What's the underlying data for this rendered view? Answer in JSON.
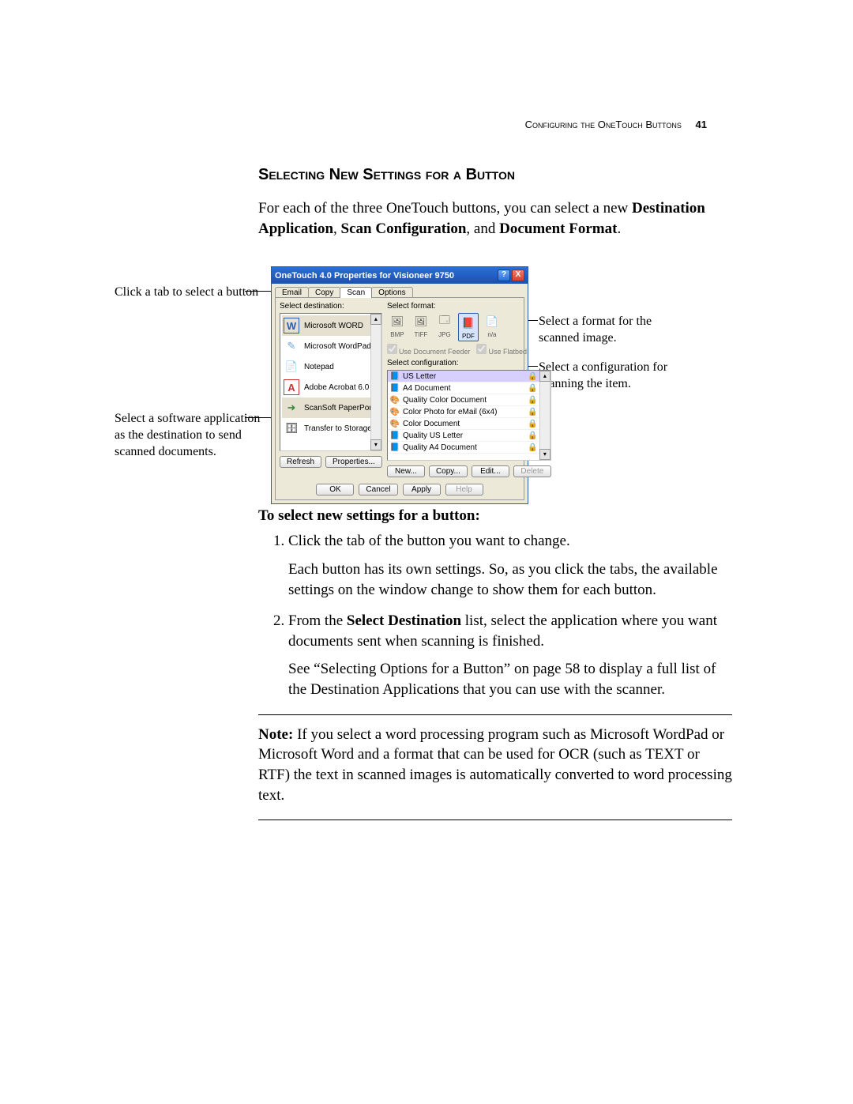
{
  "header": {
    "running": "Configuring the OneTouch Buttons",
    "page_num": "41"
  },
  "section_title": "Selecting New Settings for a Button",
  "intro": {
    "pre": "For each of the three OneTouch buttons, you can select a new ",
    "b1": "Destination Application",
    "sep1": ", ",
    "b2": "Scan Configuration",
    "sep2": ", and ",
    "b3": "Document Format",
    "post": "."
  },
  "callouts": {
    "tab": "Click a tab to select a button",
    "dest": "Select a software application as the destination to send scanned documents.",
    "fmt": "Select a format for the scanned image.",
    "cfg": "Select a configuration for scanning the item."
  },
  "dialog": {
    "title": "OneTouch 4.0 Properties for Visioneer 9750",
    "help_btn": "?",
    "close_btn": "X",
    "tabs": [
      "Email",
      "Copy",
      "Scan",
      "Options"
    ],
    "active_tab": 2,
    "labels": {
      "dest": "Select destination:",
      "fmt": "Select format:",
      "cfg": "Select configuration:"
    },
    "destinations": [
      {
        "icon": "W",
        "iconColor": "#2a5db0",
        "label": "Microsoft WORD",
        "selected": true
      },
      {
        "icon": "✎",
        "iconColor": "#6aa5e8",
        "label": "Microsoft WordPad"
      },
      {
        "icon": "📄",
        "iconColor": "#888",
        "label": "Notepad"
      },
      {
        "icon": "A",
        "iconColor": "#c33",
        "label": "Adobe Acrobat 6.0"
      },
      {
        "icon": "➜",
        "iconColor": "#3a8a3a",
        "label": "ScanSoft PaperPort",
        "selected": true
      },
      {
        "icon": "🗄",
        "iconColor": "#c7a24a",
        "label": "Transfer to Storage"
      }
    ],
    "formats": [
      {
        "abbr": "BMP",
        "glyph": "🖼"
      },
      {
        "abbr": "TIFF",
        "glyph": "🖼"
      },
      {
        "abbr": "JPG",
        "glyph": "🗔"
      },
      {
        "abbr": "PDF",
        "glyph": "📕",
        "selected": true
      },
      {
        "abbr": "n/a",
        "glyph": "📄"
      }
    ],
    "checkboxes": {
      "feeder": "Use Document Feeder",
      "flatbed": "Use Flatbed"
    },
    "configs": [
      {
        "icon": "📘",
        "label": "US Letter",
        "selected": true
      },
      {
        "icon": "📘",
        "label": "A4 Document"
      },
      {
        "icon": "🎨",
        "label": "Quality Color Document"
      },
      {
        "icon": "🎨",
        "label": "Color Photo for eMail (6x4)"
      },
      {
        "icon": "🎨",
        "label": "Color Document"
      },
      {
        "icon": "📘",
        "label": "Quality US Letter"
      },
      {
        "icon": "📘",
        "label": "Quality A4 Document"
      }
    ],
    "buttons": {
      "refresh": "Refresh",
      "properties": "Properties...",
      "new": "New...",
      "copy": "Copy...",
      "edit": "Edit...",
      "delete": "Delete",
      "ok": "OK",
      "cancel": "Cancel",
      "apply": "Apply",
      "help": "Help"
    }
  },
  "instr_heading": "To select new settings for a button:",
  "steps": {
    "s1a": "Click the tab of the button you want to change.",
    "s1b": "Each button has its own settings. So, as you click the tabs, the available settings on the window change to show them for each button.",
    "s2a_pre": "From the ",
    "s2a_b": "Select Destination",
    "s2a_post": " list, select the application where you want documents sent when scanning is finished.",
    "s2b": "See “Selecting Options for a Button” on page 58 to display a full list of the Destination Applications that you can use with the scanner."
  },
  "note": {
    "lead": "Note:",
    "body": " If you select a word processing program such as Microsoft WordPad or Microsoft Word and a format that can be used for OCR (such as TEXT or RTF) the text in scanned images is automatically converted to word processing text."
  }
}
